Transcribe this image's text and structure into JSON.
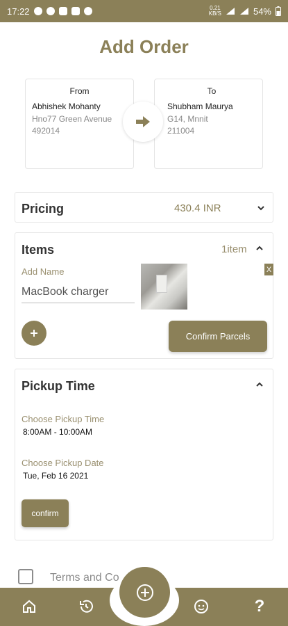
{
  "status_bar": {
    "time": "17:22",
    "speed_top": "0.21",
    "speed_unit": "KB/S",
    "battery": "54%"
  },
  "page": {
    "title": "Add Order"
  },
  "from": {
    "heading": "From",
    "name": "Abhishek Mohanty",
    "address_line1": "Hno77 Green Avenue",
    "address_line2": "492014"
  },
  "to": {
    "heading": "To",
    "name": "Shubham Maurya",
    "address_line1": "G14, Mnnit",
    "address_line2": "211004"
  },
  "pricing": {
    "label": "Pricing",
    "amount": "430.4 INR"
  },
  "items": {
    "label": "Items",
    "count": "1item",
    "field_label": "Add Name",
    "field_value": "MacBook charger",
    "remove_label": "X",
    "confirm_label": "Confirm Parcels"
  },
  "pickup": {
    "label": "Pickup Time",
    "time_label": "Choose Pickup Time",
    "time_value": "8:00AM - 10:00AM",
    "date_label": "Choose Pickup Date",
    "date_value": "Tue, Feb 16 2021",
    "confirm_label": "confirm"
  },
  "terms": {
    "label": "Terms and Co"
  },
  "icons": {
    "accent": "#8b8058"
  }
}
